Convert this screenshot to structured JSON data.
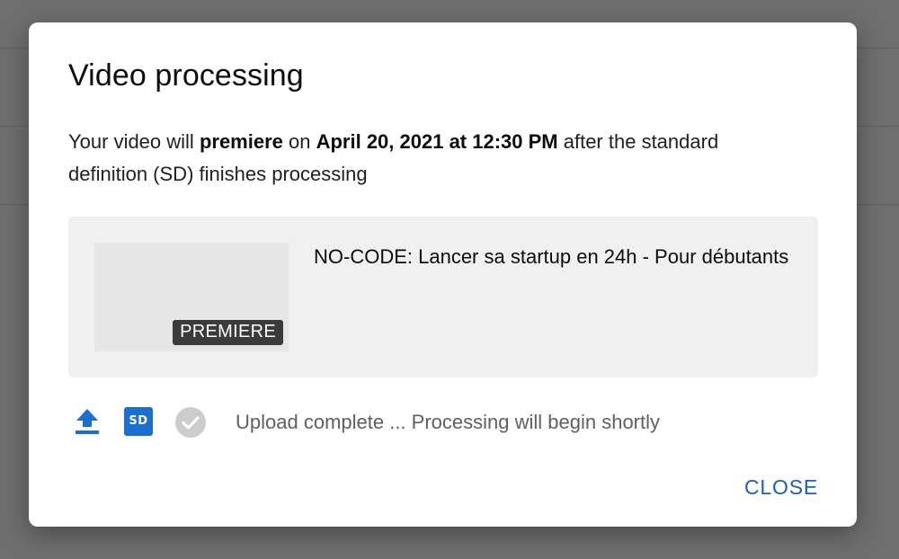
{
  "dialog": {
    "title": "Video processing",
    "description": {
      "part1": "Your video will ",
      "bold1": "premiere",
      "part2": " on ",
      "bold2": "April 20, 2021 at 12:30 PM",
      "part3": " after the standard definition (SD) finishes processing"
    },
    "video": {
      "title": "NO-CODE: Lancer sa startup en 24h - Pour débutants",
      "badge": "PREMIERE"
    },
    "status": {
      "sd_label": "SD",
      "text": "Upload complete ... Processing will begin shortly"
    },
    "close_label": "CLOSE"
  },
  "colors": {
    "accent": "#1a6fd1",
    "close": "#1a5fbf",
    "check_gray": "#cccccc"
  },
  "icons": {
    "upload": "upload-icon",
    "sd": "sd-icon",
    "check": "check-circle-icon"
  }
}
